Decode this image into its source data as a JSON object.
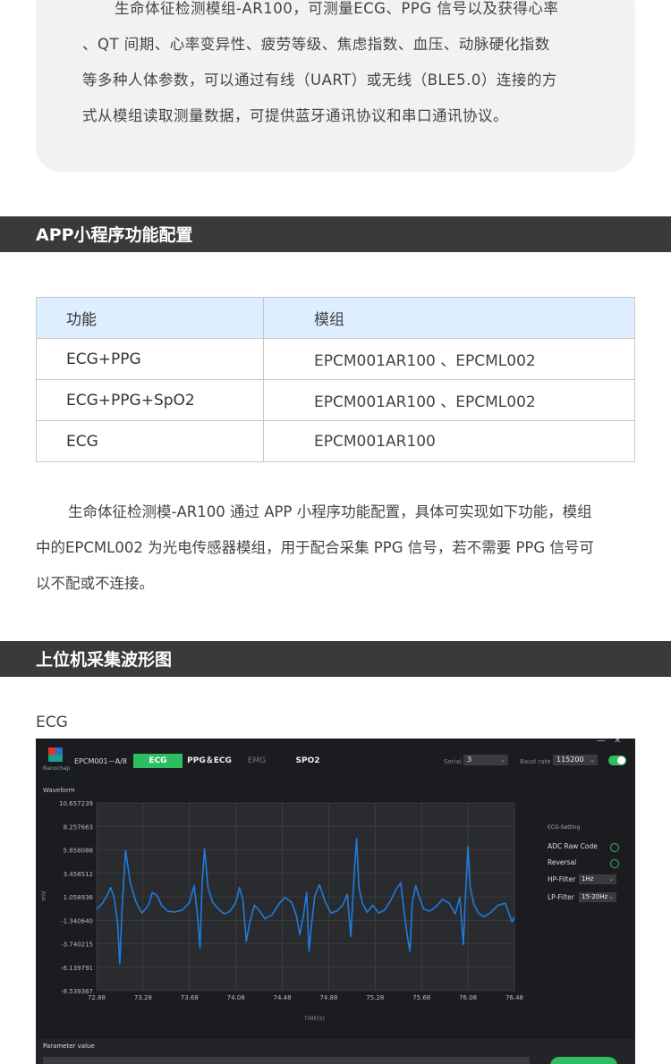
{
  "intro": {
    "line1": "生命体征检测模组-AR100，可测量ECG、PPG 信号以及获得心率",
    "line2": "、QT 间期、心率变异性、疲劳等级、焦虑指数、血压、动脉硬化指数",
    "line3": "等多种人体参数，可以通过有线（UART）或无线（BLE5.0）连接的方",
    "line4": "式从模组读取测量数据，可提供蓝牙通讯协议和串口通讯协议。"
  },
  "section1": {
    "title": "APP小程序功能配置"
  },
  "table": {
    "header": {
      "func": "功能",
      "module": "模组"
    },
    "rows": [
      {
        "func": "ECG+PPG",
        "module": "EPCM001AR100 、EPCML002"
      },
      {
        "func": "ECG+PPG+SpO2",
        "module": "EPCM001AR100 、EPCML002"
      },
      {
        "func": "ECG",
        "module": "EPCM001AR100"
      }
    ]
  },
  "paragraph": {
    "line1": "生命体征检测模-AR100 通过 APP 小程序功能配置，具体可实现如下功能，模组",
    "line2": "中的EPCML002 为光电传感器模组，用于配合采集 PPG 信号，若不需要 PPG 信号可",
    "line3": "以不配或不连接。"
  },
  "section2": {
    "title": "上位机采集波形图"
  },
  "ecg_label": "ECG",
  "app": {
    "logo_text": "Nanochap",
    "device": "EPCM001－A/8",
    "tabs": {
      "ecg": "ECG",
      "ppg": "PPG＆ECG",
      "emg": "EMG",
      "spo2": "SPO2"
    },
    "window_controls": {
      "minimize": "—",
      "close": "✕"
    },
    "serial_label": "Serial",
    "serial_value": "3",
    "baud_label": "Baud rate",
    "baud_value": "115200",
    "dropdown_arrow": "⌄",
    "waveform_title": "Waveform",
    "y_unit": "mV",
    "x_unit": "TIME(S)",
    "settings": {
      "title": "ECG-Setting",
      "adc_raw": "ADC Raw Code",
      "reversal": "Reversal",
      "hp_label": "HP-Filter",
      "hp_value": "1Hz",
      "lp_label": "LP-Filter",
      "lp_value": "15-20Hz"
    },
    "param_title": "Parameter value",
    "colors": {
      "accent": "#2fbd62",
      "trace": "#1f7bdc",
      "bg": "#1b1c1f",
      "plot_bg": "#2a2b2f"
    }
  },
  "chart_data": {
    "type": "line",
    "xlabel": "TIME(S)",
    "ylabel": "mV",
    "xlim": [
      72.88,
      76.48
    ],
    "ylim": [
      -8.539367,
      10.657239
    ],
    "x_ticks": [
      "72.88",
      "73.28",
      "73.68",
      "74.08",
      "74.48",
      "74.88",
      "75.28",
      "75.68",
      "76.08",
      "76.48"
    ],
    "y_ticks": [
      "10.657239",
      "8.257663",
      "5.858088",
      "3.458512",
      "1.058936",
      "-1.340640",
      "-3.740215",
      "-6.139791",
      "-8.539367"
    ],
    "grid": true,
    "series": [
      {
        "x": [
          72.88,
          72.93,
          72.97,
          73.0,
          73.03,
          73.06,
          73.08,
          73.1,
          73.13,
          73.17,
          73.22,
          73.27,
          73.3,
          73.33,
          73.36,
          73.4,
          73.44,
          73.49,
          73.55,
          73.62,
          73.68,
          73.72,
          73.75,
          73.77,
          73.79,
          73.81,
          73.84,
          73.88,
          73.93,
          73.98,
          74.03,
          74.08,
          74.11,
          74.14,
          74.17,
          74.2,
          74.24,
          74.28,
          74.33,
          74.39,
          74.45,
          74.5,
          74.56,
          74.6,
          74.63,
          74.66,
          74.69,
          74.71,
          74.73,
          74.76,
          74.8,
          74.85,
          74.9,
          74.95,
          75.0,
          75.04,
          75.07,
          75.1,
          75.12,
          75.14,
          75.17,
          75.21,
          75.26,
          75.31,
          75.36,
          75.41,
          75.46,
          75.5,
          75.53,
          75.56,
          75.58,
          75.6,
          75.63,
          75.66,
          75.7,
          75.75,
          75.8,
          75.86,
          75.92,
          75.97,
          76.01,
          76.04,
          76.06,
          76.08,
          76.1,
          76.13,
          76.17,
          76.22,
          76.28,
          76.34,
          76.4,
          76.46,
          76.48
        ],
        "y": [
          -0.2,
          0.4,
          1.2,
          2.0,
          1.0,
          -1.5,
          -5.8,
          0.0,
          5.8,
          2.5,
          0.5,
          -0.6,
          -0.2,
          0.3,
          1.5,
          1.2,
          0.2,
          -0.4,
          -0.5,
          -0.3,
          0.5,
          2.2,
          -1.0,
          -4.2,
          2.5,
          6.0,
          2.0,
          0.5,
          -0.2,
          -0.7,
          -0.4,
          0.5,
          2.0,
          0.8,
          -3.5,
          -1.5,
          0.2,
          -0.3,
          -1.2,
          -0.8,
          0.3,
          1.0,
          0.5,
          -0.8,
          -2.8,
          -1.0,
          1.5,
          -4.5,
          -2.0,
          1.2,
          2.3,
          0.5,
          -0.6,
          -0.4,
          0.2,
          1.3,
          -3.0,
          3.5,
          7.0,
          2.0,
          0.4,
          -0.5,
          0.2,
          -0.6,
          -0.3,
          0.6,
          1.8,
          2.5,
          -0.6,
          -3.2,
          -4.5,
          0.5,
          2.2,
          1.0,
          -0.2,
          -0.4,
          0.0,
          0.8,
          0.4,
          -0.7,
          1.0,
          -3.8,
          1.5,
          6.2,
          2.0,
          0.3,
          -0.6,
          -1.0,
          -0.5,
          0.2,
          0.4,
          -1.5,
          -1.0
        ]
      }
    ]
  }
}
